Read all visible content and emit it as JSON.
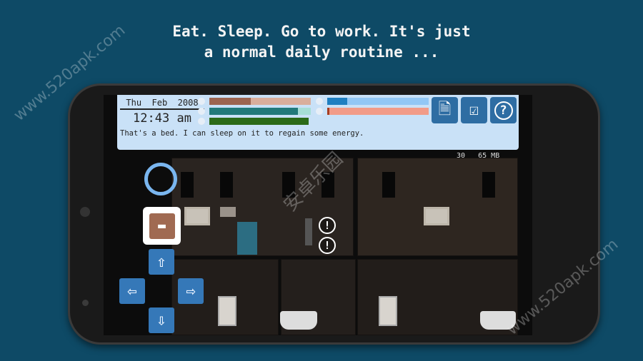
{
  "caption": {
    "line1": "Eat. Sleep. Go to work. It's just",
    "line2": "a normal daily routine ..."
  },
  "hud": {
    "date": "Thu  Feb  2008",
    "time": "12:43 am",
    "message": "That's a bed. I can sleep on it to regain some energy.",
    "stat_bars": [
      {
        "icon": "food-icon",
        "fill": 0.41,
        "color": "#9c6450",
        "bg": "#d9ae9c"
      },
      {
        "icon": "energy-icon",
        "fill": 0.87,
        "color": "#21797a",
        "bg": "#a6ded6"
      },
      {
        "icon": "health-icon",
        "fill": 0.98,
        "color": "#2b6a18",
        "bg": "#c9e1f7"
      }
    ],
    "time_bars": [
      {
        "icon": "clock-icon",
        "fill": 0.2,
        "color": "#1f7fc1",
        "bg": "#92c7f5"
      },
      {
        "icon": "clock-icon",
        "fill": 0.02,
        "color": "#a63e22",
        "bg": "#f19b88"
      }
    ],
    "buttons": [
      {
        "icon": "document-icon"
      },
      {
        "icon": "clipboard-check-icon"
      },
      {
        "icon": "help-icon",
        "glyph": "?"
      }
    ],
    "fps": "30",
    "memory": "65 MB"
  },
  "controls": {
    "bed_icon": "bed-icon",
    "colors": {
      "button": "#3578b8",
      "bed": "#a06a52"
    }
  },
  "alerts": [
    "!",
    "!"
  ],
  "watermarks": {
    "site": "www.520apk.com",
    "chinese": "安卓乐园"
  }
}
